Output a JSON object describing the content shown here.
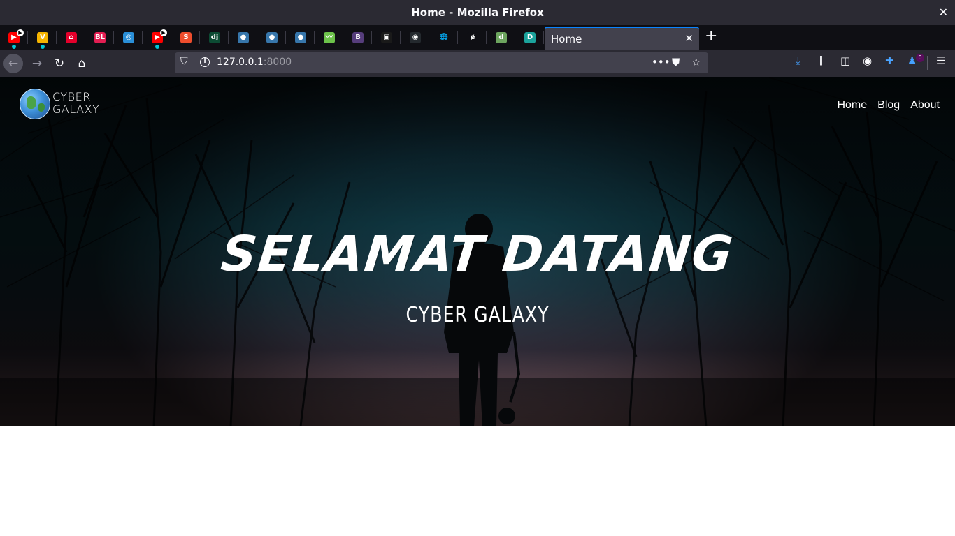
{
  "window": {
    "title": "Home - Mozilla Firefox",
    "close_glyph": "✕"
  },
  "tabs": {
    "pinned": [
      {
        "icon": "youtube-icon",
        "color": "#ff0000",
        "text": "▶",
        "indicator": true,
        "badge": true
      },
      {
        "icon": "bulb-icon",
        "color": "#f5b400",
        "text": "V",
        "indicator": true,
        "badge": false
      },
      {
        "icon": "house-icon",
        "color": "#e4002b",
        "text": "⌂",
        "indicator": false,
        "badge": false
      },
      {
        "icon": "bl-icon",
        "color": "#e31e52",
        "text": "BL",
        "indicator": false,
        "badge": false
      },
      {
        "icon": "circle-logo-icon",
        "color": "#2a8fd8",
        "text": "◎",
        "indicator": false,
        "badge": false
      },
      {
        "icon": "youtube-icon",
        "color": "#ff0000",
        "text": "▶",
        "indicator": true,
        "badge": true
      },
      {
        "icon": "shopee-icon",
        "color": "#ee4d2d",
        "text": "S",
        "indicator": false,
        "badge": false
      },
      {
        "icon": "django-icon",
        "color": "#0c4b33",
        "text": "dj",
        "indicator": false,
        "badge": false
      },
      {
        "icon": "python-icon",
        "color": "#3776ab",
        "text": "●",
        "indicator": false,
        "badge": false
      },
      {
        "icon": "python-icon",
        "color": "#3776ab",
        "text": "●",
        "indicator": false,
        "badge": false
      },
      {
        "icon": "python-icon",
        "color": "#3776ab",
        "text": "●",
        "indicator": false,
        "badge": false
      },
      {
        "icon": "chart-app-icon",
        "color": "#6cc24a",
        "text": "〰",
        "indicator": false,
        "badge": false
      },
      {
        "icon": "bootstrap-icon",
        "color": "#563d7c",
        "text": "B",
        "indicator": false,
        "badge": false
      },
      {
        "icon": "inbox-icon",
        "color": "#1a1a1a",
        "text": "▣",
        "indicator": false,
        "badge": false
      },
      {
        "icon": "github-icon",
        "color": "#24292e",
        "text": "◉",
        "indicator": false,
        "badge": false
      },
      {
        "icon": "globe-icon",
        "color": "#0f0f14",
        "text": "🌐",
        "indicator": false,
        "badge": false
      },
      {
        "icon": "stylized-e-icon",
        "color": "#0f0f14",
        "text": "ɇ",
        "indicator": false,
        "badge": false
      },
      {
        "icon": "d-icon",
        "color": "#6da55f",
        "text": "d",
        "indicator": false,
        "badge": false
      },
      {
        "icon": "d-docs-icon",
        "color": "#1ba39c",
        "text": "D",
        "indicator": false,
        "badge": false
      }
    ],
    "active": {
      "label": "Home",
      "close": "✕"
    },
    "new_tab": "+"
  },
  "navbar": {
    "url_host": "127.0.0.1",
    "url_port": ":8000",
    "notification_count": "0"
  },
  "page": {
    "logo": {
      "line1": "CYBER",
      "line2": "GALAXY"
    },
    "nav": [
      "Home",
      "Blog",
      "About"
    ],
    "headline": "SELAMAT DATANG",
    "subheadline": "CYBER GALAXY"
  }
}
